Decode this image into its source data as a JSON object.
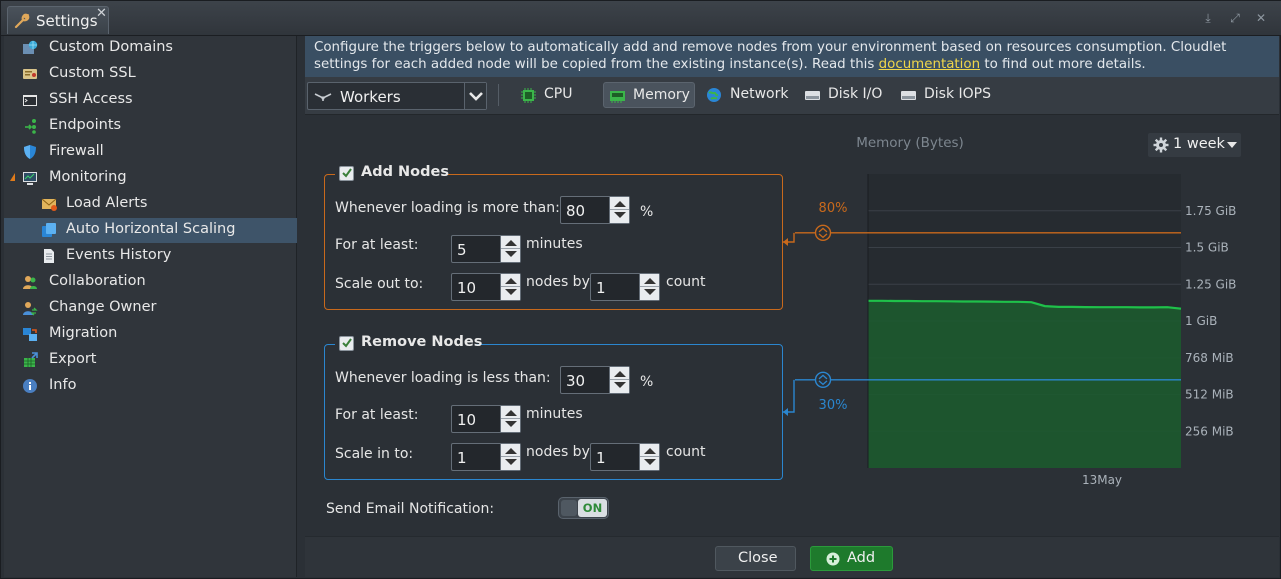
{
  "window": {
    "tab_title": "Settings"
  },
  "sidebar": {
    "items": [
      {
        "label": "Custom Domains",
        "icon": "globe-icon"
      },
      {
        "label": "Custom SSL",
        "icon": "certificate-icon"
      },
      {
        "label": "SSH Access",
        "icon": "terminal-icon"
      },
      {
        "label": "Endpoints",
        "icon": "endpoints-icon"
      },
      {
        "label": "Firewall",
        "icon": "shield-icon"
      },
      {
        "label": "Monitoring",
        "icon": "monitor-icon"
      },
      {
        "label": "Load Alerts",
        "icon": "envelope-icon"
      },
      {
        "label": "Auto Horizontal Scaling",
        "icon": "scaling-icon"
      },
      {
        "label": "Events History",
        "icon": "document-icon"
      },
      {
        "label": "Collaboration",
        "icon": "users-icon"
      },
      {
        "label": "Change Owner",
        "icon": "user-swap-icon"
      },
      {
        "label": "Migration",
        "icon": "migration-icon"
      },
      {
        "label": "Export",
        "icon": "export-icon"
      },
      {
        "label": "Info",
        "icon": "info-icon"
      }
    ],
    "selected": "Auto Horizontal Scaling"
  },
  "info_text": {
    "before_link": "Configure the triggers below to automatically add and remove nodes from your environment based on resources consumption. Cloudlet settings for each added node will be copied from the existing instance(s). Read this ",
    "link": "documentation",
    "after_link": " to find out more details."
  },
  "toolbar": {
    "layer": "Workers",
    "tabs": [
      {
        "label": "CPU",
        "icon": "cpu-icon"
      },
      {
        "label": "Memory",
        "icon": "memory-icon",
        "active": true
      },
      {
        "label": "Network",
        "icon": "network-icon"
      },
      {
        "label": "Disk I/O",
        "icon": "disk-icon"
      },
      {
        "label": "Disk IOPS",
        "icon": "disk-iops-icon"
      }
    ]
  },
  "add_nodes": {
    "title": "Add Nodes",
    "checked": true,
    "loading_label": "Whenever loading is more than:",
    "loading_value": "80",
    "loading_unit": "%",
    "duration_label": "For at least:",
    "duration_value": "5",
    "duration_unit": "minutes",
    "scale_label": "Scale out to:",
    "scale_value": "10",
    "scale_unit": "nodes by",
    "step_value": "1",
    "step_unit": "count",
    "accent_color": "#c8691c"
  },
  "remove_nodes": {
    "title": "Remove Nodes",
    "checked": true,
    "loading_label": "Whenever loading is less than:",
    "loading_value": "30",
    "loading_unit": "%",
    "duration_label": "For at least:",
    "duration_value": "10",
    "duration_unit": "minutes",
    "scale_label": "Scale in to:",
    "scale_value": "1",
    "scale_unit": "nodes by",
    "step_value": "1",
    "step_unit": "count",
    "accent_color": "#2b86cf"
  },
  "email": {
    "label": "Send Email Notification:",
    "toggle": "ON"
  },
  "period": {
    "label": "1 week"
  },
  "chart_data": {
    "type": "area",
    "title": "Memory (Bytes)",
    "x_tick_labels": [
      "13May"
    ],
    "y_tick_labels": [
      "256 MiB",
      "512 MiB",
      "768 MiB",
      "1 GiB",
      "1.25 GiB",
      "1.5 GiB",
      "1.75 GiB"
    ],
    "y_ticks_mib": [
      256,
      512,
      768,
      1024,
      1280,
      1536,
      1792
    ],
    "ylim_mib": [
      0,
      2048
    ],
    "series": [
      {
        "color": "#1fc14a",
        "values_mib": [
          1165,
          1165,
          1163,
          1163,
          1162,
          1162,
          1161,
          1160,
          1160,
          1159,
          1158,
          1158,
          1155,
          1128,
          1122,
          1122,
          1121,
          1120,
          1120,
          1120,
          1119,
          1119,
          1120,
          1110
        ]
      }
    ],
    "thresholds": [
      {
        "label": "80%",
        "value_mib": 1638,
        "color": "#c8691c"
      },
      {
        "label": "30%",
        "value_mib": 614,
        "color": "#2b86cf"
      }
    ]
  },
  "footer": {
    "close_label": "Close",
    "add_label": "Add"
  }
}
